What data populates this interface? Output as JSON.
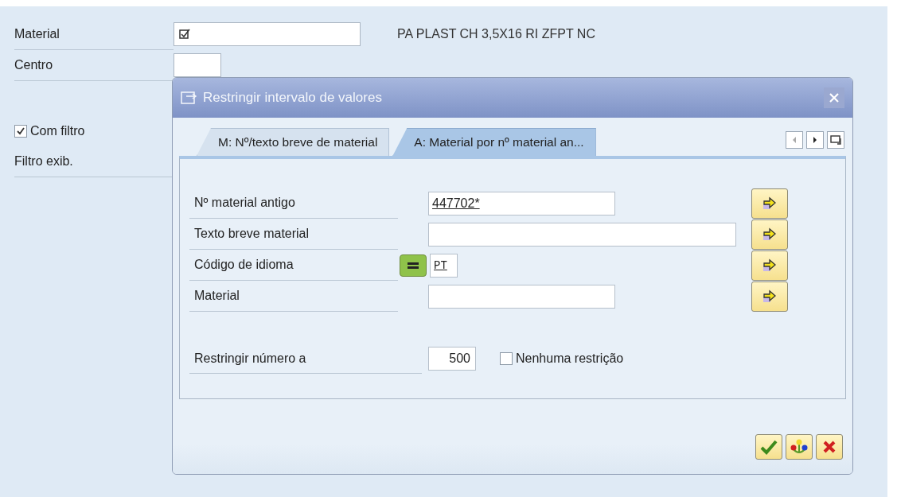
{
  "main_form": {
    "material": {
      "label": "Material",
      "description": "PA PLAST CH 3,5X16 RI ZFPT NC"
    },
    "centro": {
      "label": "Centro"
    },
    "com_filtro": {
      "label": "Com filtro",
      "checked": true
    },
    "filtro_exib": {
      "label": "Filtro exib."
    }
  },
  "dialog": {
    "title": "Restringir intervalo de valores",
    "tabs": [
      {
        "label": "M: Nº/texto breve de material",
        "selected": false
      },
      {
        "label": "A: Material por nº material an...",
        "selected": true
      }
    ],
    "fields": [
      {
        "label": "Nº material antigo",
        "value": "447702*",
        "kind": "medium"
      },
      {
        "label": "Texto breve material",
        "kind": "wide"
      },
      {
        "label": "Código de idioma",
        "value": "PT",
        "kind": "code"
      },
      {
        "label": "Material",
        "kind": "medium"
      }
    ],
    "limit": {
      "label": "Restringir número a",
      "value": "500"
    },
    "no_limit": {
      "label": "Nenhuma restrição",
      "checked": false
    }
  }
}
